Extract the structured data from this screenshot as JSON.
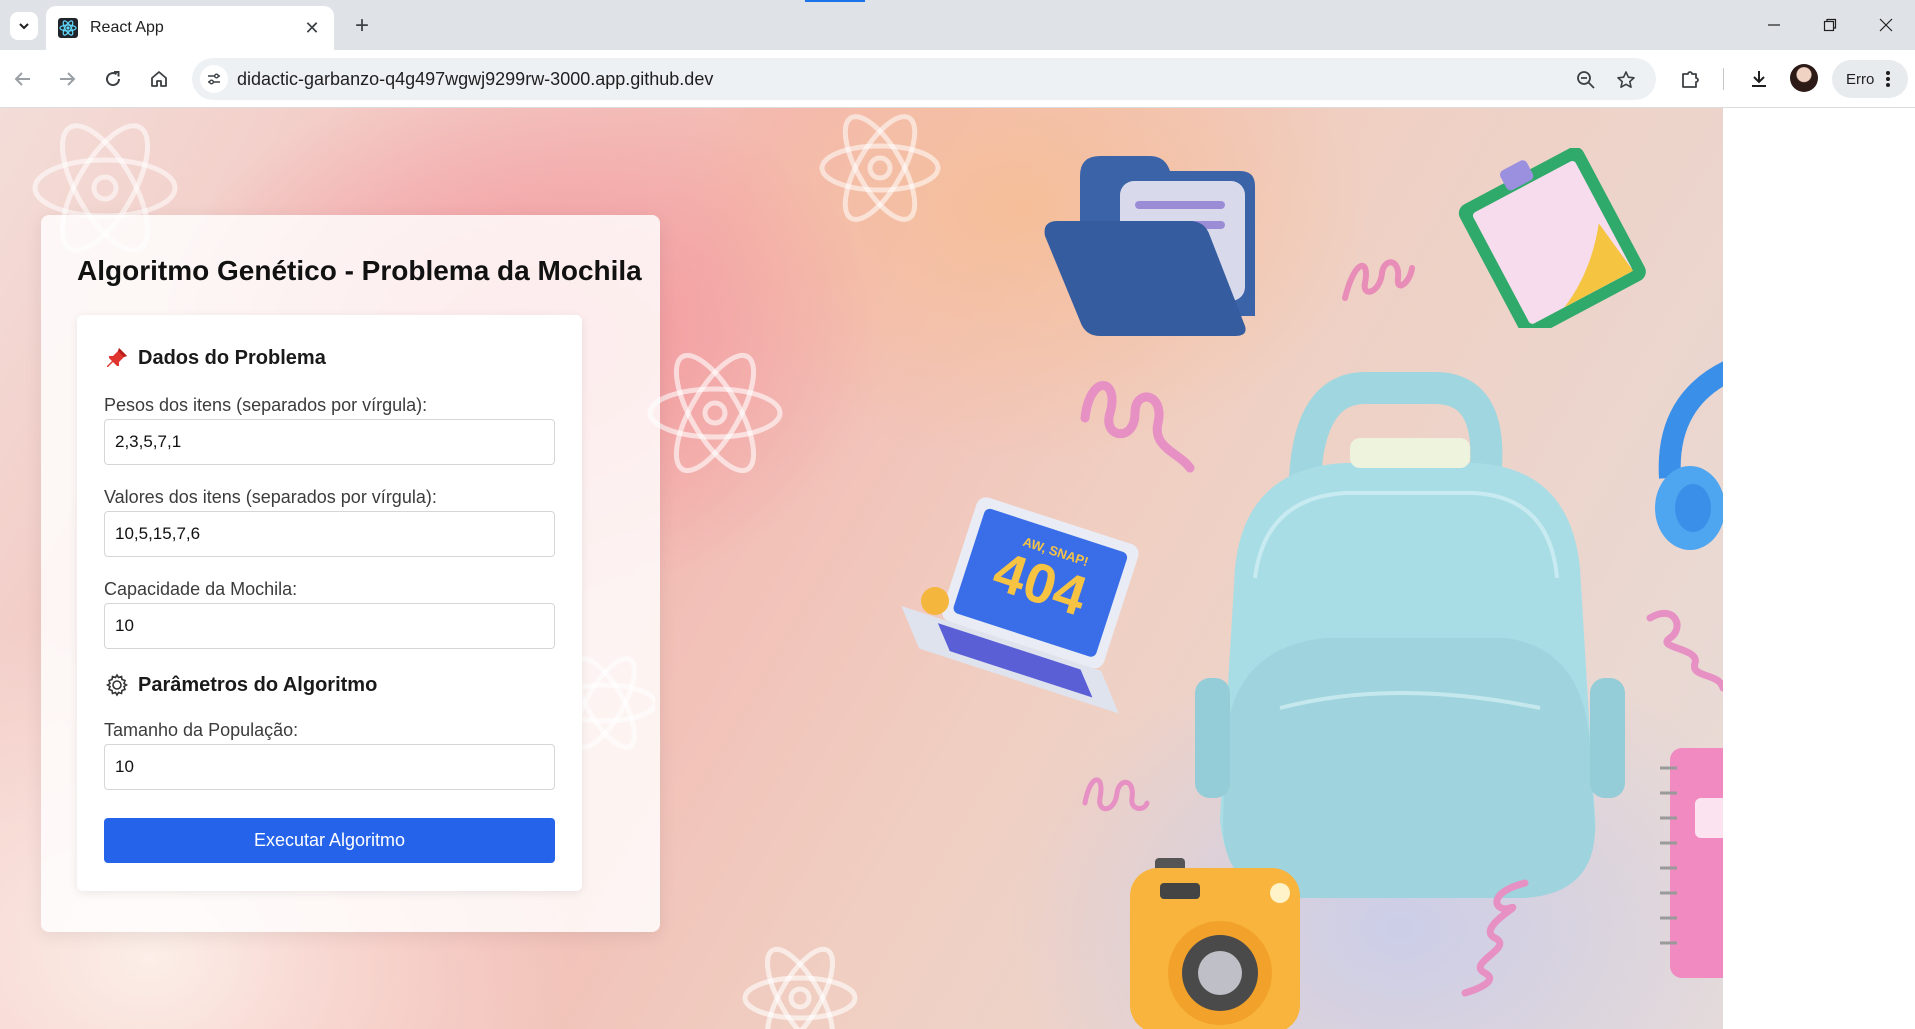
{
  "browser": {
    "tab_title": "React App",
    "url": "didactic-garbanzo-q4g497wgwj9299rw-3000.app.github.dev",
    "profile_label": "Erro"
  },
  "app": {
    "title": "Algoritmo Genético - Problema da Mochila",
    "problem_section": {
      "title": "Dados do Problema",
      "weights_label": "Pesos dos itens (separados por vírgula):",
      "weights_value": "2,3,5,7,1",
      "values_label": "Valores dos itens (separados por vírgula):",
      "values_value": "10,5,15,7,6",
      "capacity_label": "Capacidade da Mochila:",
      "capacity_value": "10"
    },
    "params_section": {
      "title": "Parâmetros do Algoritmo",
      "population_label": "Tamanho da População:",
      "population_value": "10"
    },
    "run_button_label": "Executar Algoritmo"
  },
  "background_illustration": {
    "laptop_screen_text": "404",
    "laptop_banner_text": "AW, SNAP!"
  },
  "colors": {
    "primary_button": "#2563eb",
    "load_indicator": "#1a73e8"
  }
}
